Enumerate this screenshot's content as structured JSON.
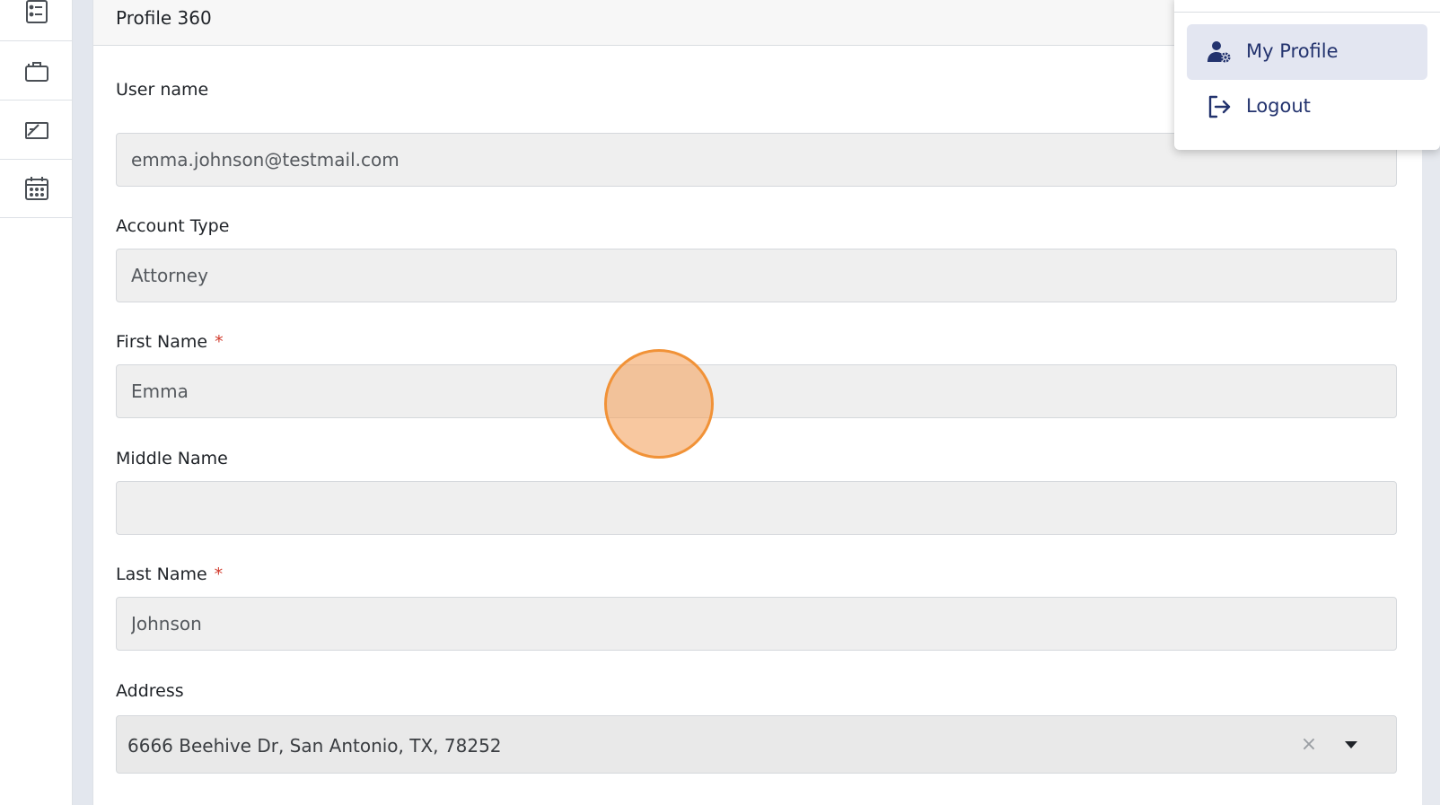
{
  "sidebar": {
    "items": [
      {
        "icon": "checklist-icon"
      },
      {
        "icon": "briefcase-icon"
      },
      {
        "icon": "documents-icon"
      },
      {
        "icon": "calendar-icon"
      }
    ]
  },
  "header": {
    "title": "Profile 360"
  },
  "form": {
    "username": {
      "label": "User name",
      "value": "emma.johnson@testmail.com"
    },
    "account_type": {
      "label": "Account Type",
      "value": "Attorney"
    },
    "first_name": {
      "label": "First Name",
      "required_mark": "*",
      "value": "Emma"
    },
    "middle_name": {
      "label": "Middle Name",
      "value": ""
    },
    "last_name": {
      "label": "Last Name",
      "required_mark": "*",
      "value": "Johnson"
    },
    "address": {
      "label": "Address",
      "value": "6666 Beehive Dr, San Antonio, TX, 78252",
      "clear_glyph": "×"
    }
  },
  "user_menu": {
    "items": [
      {
        "label": "My Profile",
        "icon": "user-gear-icon",
        "active": true
      },
      {
        "label": "Logout",
        "icon": "logout-icon",
        "active": false
      }
    ]
  },
  "colors": {
    "accent": "#23336e",
    "required": "#d13b2d",
    "click_marker": "#f19237"
  }
}
